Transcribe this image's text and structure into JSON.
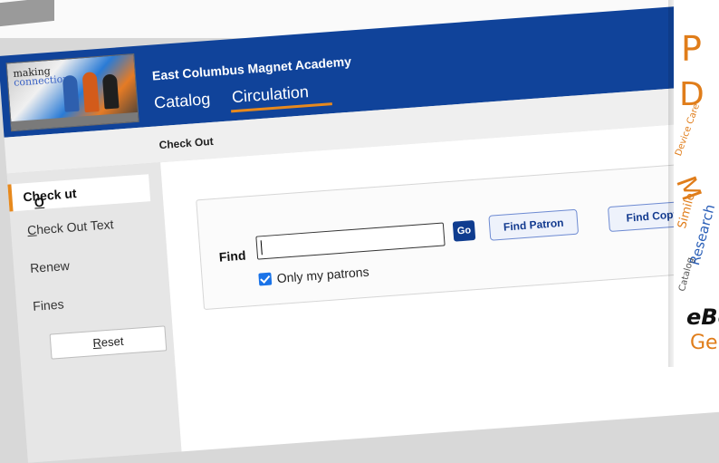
{
  "header": {
    "logo_text_line1": "making",
    "logo_text_line2": "connections",
    "school_name": "East Columbus Magnet Academy",
    "tabs": [
      {
        "label": "Catalog",
        "active": false
      },
      {
        "label": "Circulation",
        "active": true
      }
    ]
  },
  "subheader": {
    "title": "Check Out"
  },
  "sidebar": {
    "items": [
      {
        "label": "Check Out",
        "active": true
      },
      {
        "label": "Check Out Text",
        "active": false
      },
      {
        "label": "Renew",
        "active": false
      },
      {
        "label": "Fines",
        "active": false
      }
    ],
    "reset_label": "Reset"
  },
  "find_panel": {
    "find_label": "Find",
    "input_value": "",
    "go_label": "Go",
    "find_patron_label": "Find Patron",
    "find_copy_label": "Find Copy",
    "only_my_patrons_label": "Only my patrons",
    "only_my_patrons_checked": true
  },
  "word_cloud": {
    "words": [
      "P",
      "D",
      "Device Care",
      "Simile",
      "Research",
      "eBo",
      "Gen",
      "Catalog",
      "M"
    ]
  },
  "colors": {
    "banner": "#10439a",
    "accent_orange": "#e7891d",
    "go_button": "#0f3c8f",
    "checkbox": "#1a73e8"
  }
}
